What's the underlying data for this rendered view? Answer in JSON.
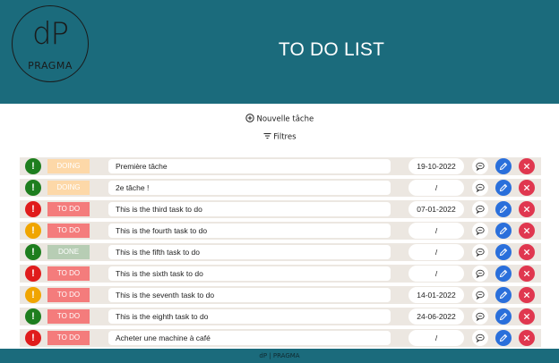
{
  "header": {
    "logo_mark": "dP",
    "logo_word": "PRAGMA",
    "title": "TO DO LIST"
  },
  "actions": {
    "new_task_label": "Nouvelle tâche",
    "filters_label": "Filtres"
  },
  "tasks": [
    {
      "priority": "!",
      "priority_color": "green",
      "status": "DOING",
      "status_kind": "doing",
      "title": "Première tâche",
      "date": "19-10-2022"
    },
    {
      "priority": "!",
      "priority_color": "green",
      "status": "DOING",
      "status_kind": "doing",
      "title": "2e tâche !",
      "date": "/"
    },
    {
      "priority": "!",
      "priority_color": "red",
      "status": "TO DO",
      "status_kind": "todo",
      "title": "This is the third task to do",
      "date": "07-01-2022"
    },
    {
      "priority": "!",
      "priority_color": "orange",
      "status": "TO DO",
      "status_kind": "todo",
      "title": "This is the fourth task to do",
      "date": "/"
    },
    {
      "priority": "!",
      "priority_color": "green",
      "status": "DONE",
      "status_kind": "done",
      "title": "This is the fifth task to do",
      "date": "/"
    },
    {
      "priority": "!",
      "priority_color": "red",
      "status": "TO DO",
      "status_kind": "todo",
      "title": "This is the sixth task to do",
      "date": "/"
    },
    {
      "priority": "!",
      "priority_color": "orange",
      "status": "TO DO",
      "status_kind": "todo",
      "title": "This is the seventh task to do",
      "date": "14-01-2022"
    },
    {
      "priority": "!",
      "priority_color": "green",
      "status": "TO DO",
      "status_kind": "todo",
      "title": "This is the eighth task to do",
      "date": "24-06-2022"
    },
    {
      "priority": "!",
      "priority_color": "red",
      "status": "TO DO",
      "status_kind": "todo",
      "title": "Acheter une machine à café",
      "date": "/"
    }
  ],
  "icons": {
    "add": "plus-circle-icon",
    "filter": "filter-lines-icon",
    "comment": "comment-icon",
    "edit": "pencil-icon",
    "delete": "close-icon"
  },
  "colors": {
    "header_bg": "#1b6b7c",
    "row_bg": "#ece7e1",
    "priority_green": "#1e7e1e",
    "priority_red": "#e01c1c",
    "priority_orange": "#f0a500",
    "status_doing": "#fdd8a8",
    "status_todo": "#f47c7c",
    "status_done": "#b7cdb4",
    "edit_blue": "#2a6fdb",
    "delete_red": "#e0374f"
  },
  "footer": {
    "brand": "dP | PRAGMA"
  }
}
